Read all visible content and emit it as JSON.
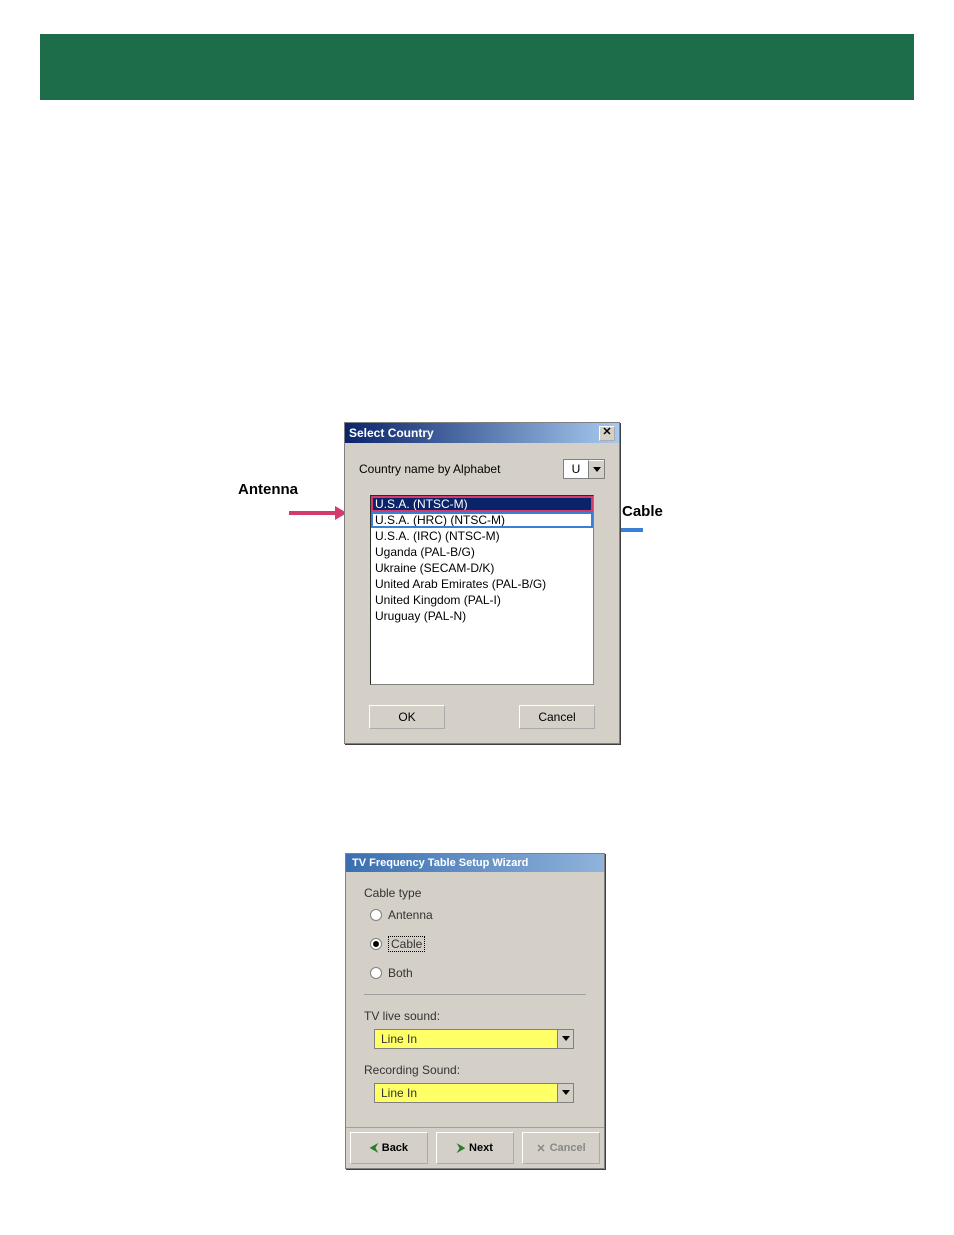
{
  "annotations": {
    "antenna": "Antenna",
    "cable": "Cable"
  },
  "dialog1": {
    "title": "Select Country",
    "alphaLabel": "Country name by Alphabet",
    "alphaValue": "U",
    "items": [
      "U.S.A. (NTSC-M)",
      "U.S.A. (HRC) (NTSC-M)",
      "U.S.A. (IRC) (NTSC-M)",
      "Uganda (PAL-B/G)",
      "Ukraine (SECAM-D/K)",
      "United Arab Emirates (PAL-B/G)",
      "United Kingdom (PAL-I)",
      "Uruguay (PAL-N)"
    ],
    "okLabel": "OK",
    "cancelLabel": "Cancel"
  },
  "dialog2": {
    "title": "TV Frequency Table Setup Wizard",
    "groupLabel": "Cable type",
    "radioAntenna": "Antenna",
    "radioCable": "Cable",
    "radioBoth": "Both",
    "tvLiveLabel": "TV live sound:",
    "tvLiveValue": "Line In",
    "recLabel": "Recording Sound:",
    "recValue": "Line In",
    "backLabel": "Back",
    "nextLabel": "Next",
    "cancelLabel": "Cancel"
  }
}
